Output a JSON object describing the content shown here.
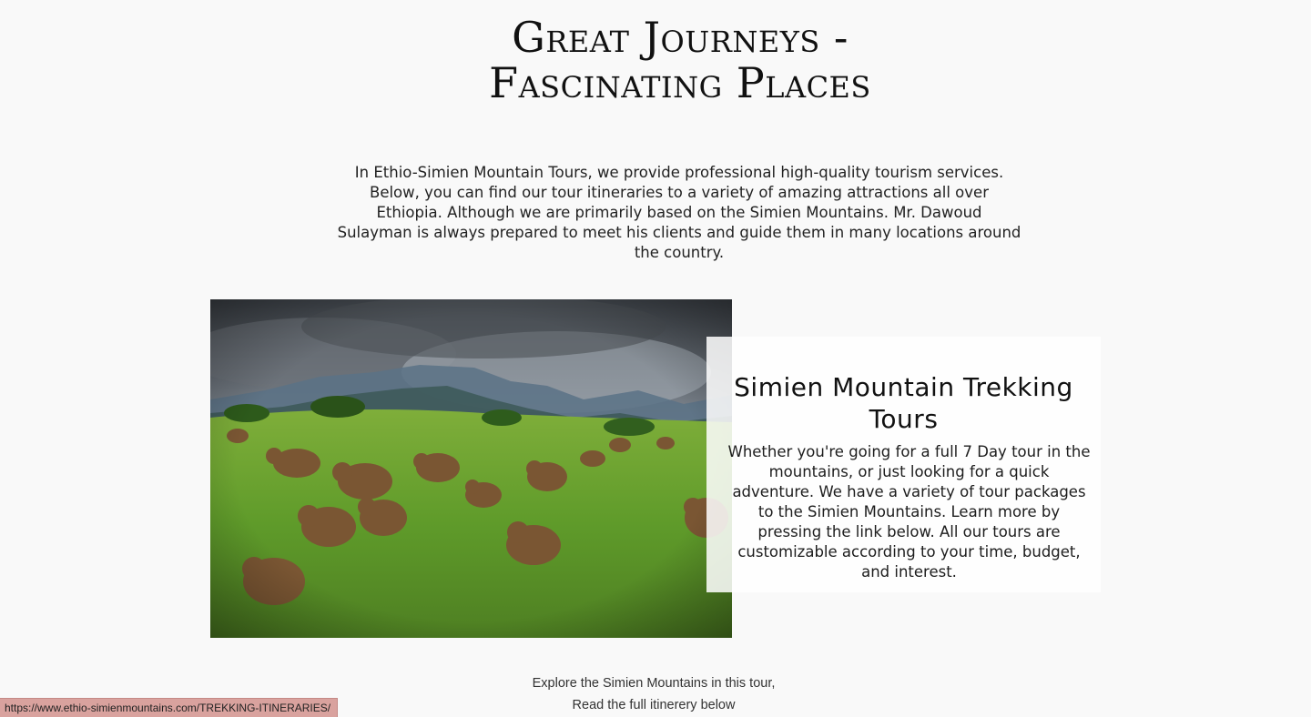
{
  "header": {
    "title_line1": "Great Journeys -",
    "title_line2": "Fascinating Places"
  },
  "intro": {
    "text": "In Ethio-Simien Mountain Tours, we provide professional high-quality tourism services. Below, you can find our tour itineraries to a variety of amazing attractions all over Ethiopia. Although we are primarily based on the Simien Mountains. Mr. Dawoud Sulayman is always prepared to meet his clients and guide them in many locations around the country."
  },
  "feature": {
    "title": "Simien Mountain Trekking Tours",
    "text": "Whether you're going for a full 7 Day tour in the mountains, or just looking for a quick adventure. We have a variety of tour packages to the Simien Mountains. Learn more by pressing the link below. All our tours are customizable according to your time, budget, and interest."
  },
  "explore": {
    "text": "Explore the Simien Mountains in this tour, Read the full itinerery below"
  },
  "status_bar": {
    "url": "https://www.ethio-simienmountains.com/TREKKING-ITINERARIES/"
  },
  "colors": {
    "background": "#f9f9f9",
    "status_bar": "#d9a29e",
    "grass": "#6fa631",
    "sky": "#5d6670"
  }
}
